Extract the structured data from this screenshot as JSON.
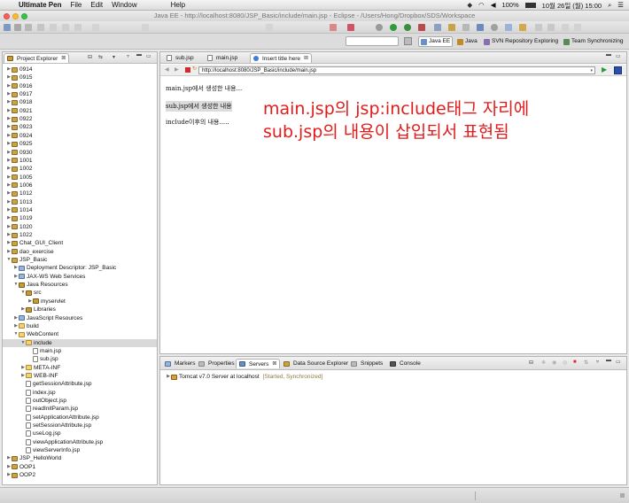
{
  "menubar": {
    "apple": "",
    "app_name": "Ultimate Pen",
    "items": [
      "File",
      "Edit",
      "Window",
      "Help"
    ],
    "battery": "100%",
    "clock": "10월 26일 (월)  15:00"
  },
  "window": {
    "title": "Java EE - http://localhost:8080/JSP_Basic/include/main.jsp - Eclipse - /Users/Hong/Dropbox/SDS/Workspace"
  },
  "perspectives": [
    {
      "label": "Java EE",
      "color": "#6b8fc7"
    },
    {
      "label": "Java",
      "color": "#c08a2a"
    },
    {
      "label": "SVN Repository Exploring",
      "color": "#8a6fb0"
    },
    {
      "label": "Team Synchronizing",
      "color": "#5a8a5a"
    }
  ],
  "explorer": {
    "tab_label": "Project Explorer",
    "tab_close": "⊠",
    "tree": [
      {
        "label": "0914",
        "indent": 0,
        "icon": "proj",
        "twisty": "▶"
      },
      {
        "label": "0915",
        "indent": 0,
        "icon": "proj",
        "twisty": "▶"
      },
      {
        "label": "0916",
        "indent": 0,
        "icon": "proj",
        "twisty": "▶"
      },
      {
        "label": "0917",
        "indent": 0,
        "icon": "proj",
        "twisty": "▶"
      },
      {
        "label": "0918",
        "indent": 0,
        "icon": "proj",
        "twisty": "▶"
      },
      {
        "label": "0921",
        "indent": 0,
        "icon": "proj",
        "twisty": "▶"
      },
      {
        "label": "0922",
        "indent": 0,
        "icon": "proj",
        "twisty": "▶"
      },
      {
        "label": "0923",
        "indent": 0,
        "icon": "proj",
        "twisty": "▶"
      },
      {
        "label": "0924",
        "indent": 0,
        "icon": "proj",
        "twisty": "▶"
      },
      {
        "label": "0925",
        "indent": 0,
        "icon": "proj",
        "twisty": "▶"
      },
      {
        "label": "0930",
        "indent": 0,
        "icon": "proj",
        "twisty": "▶"
      },
      {
        "label": "1001",
        "indent": 0,
        "icon": "proj",
        "twisty": "▶"
      },
      {
        "label": "1002",
        "indent": 0,
        "icon": "proj",
        "twisty": "▶"
      },
      {
        "label": "1005",
        "indent": 0,
        "icon": "proj",
        "twisty": "▶"
      },
      {
        "label": "1006",
        "indent": 0,
        "icon": "proj",
        "twisty": "▶"
      },
      {
        "label": "1012",
        "indent": 0,
        "icon": "proj",
        "twisty": "▶"
      },
      {
        "label": "1013",
        "indent": 0,
        "icon": "proj",
        "twisty": "▶"
      },
      {
        "label": "1014",
        "indent": 0,
        "icon": "proj",
        "twisty": "▶"
      },
      {
        "label": "1019",
        "indent": 0,
        "icon": "proj",
        "twisty": "▶"
      },
      {
        "label": "1020",
        "indent": 0,
        "icon": "proj",
        "twisty": "▶"
      },
      {
        "label": "1022",
        "indent": 0,
        "icon": "proj",
        "twisty": "▶"
      },
      {
        "label": "Chat_GUI_Client",
        "indent": 0,
        "icon": "proj",
        "twisty": "▶"
      },
      {
        "label": "dao_exercise",
        "indent": 0,
        "icon": "proj",
        "twisty": "▶"
      },
      {
        "label": "JSP_Basic",
        "indent": 0,
        "icon": "proj",
        "twisty": "▼"
      },
      {
        "label": "Deployment Descriptor: JSP_Basic",
        "indent": 1,
        "icon": "misc",
        "twisty": "▶"
      },
      {
        "label": "JAX-WS Web Services",
        "indent": 1,
        "icon": "misc",
        "twisty": "▶"
      },
      {
        "label": "Java Resources",
        "indent": 1,
        "icon": "pkg",
        "twisty": "▼"
      },
      {
        "label": "src",
        "indent": 2,
        "icon": "pkg",
        "twisty": "▼"
      },
      {
        "label": "myservlet",
        "indent": 3,
        "icon": "pkg",
        "twisty": "▶"
      },
      {
        "label": "Libraries",
        "indent": 2,
        "icon": "pkg",
        "twisty": "▶"
      },
      {
        "label": "JavaScript Resources",
        "indent": 1,
        "icon": "misc",
        "twisty": "▶"
      },
      {
        "label": "build",
        "indent": 1,
        "icon": "fold",
        "twisty": "▶"
      },
      {
        "label": "WebContent",
        "indent": 1,
        "icon": "fold",
        "twisty": "▼"
      },
      {
        "label": "include",
        "indent": 2,
        "icon": "fold",
        "twisty": "▼",
        "selected": true
      },
      {
        "label": "main.jsp",
        "indent": 3,
        "icon": "jsp",
        "twisty": ""
      },
      {
        "label": "sub.jsp",
        "indent": 3,
        "icon": "jsp",
        "twisty": ""
      },
      {
        "label": "META-INF",
        "indent": 2,
        "icon": "fold",
        "twisty": "▶"
      },
      {
        "label": "WEB-INF",
        "indent": 2,
        "icon": "fold",
        "twisty": "▶"
      },
      {
        "label": "getSessionAttribute.jsp",
        "indent": 2,
        "icon": "jsp",
        "twisty": ""
      },
      {
        "label": "index.jsp",
        "indent": 2,
        "icon": "jsp",
        "twisty": ""
      },
      {
        "label": "outObject.jsp",
        "indent": 2,
        "icon": "jsp",
        "twisty": ""
      },
      {
        "label": "readInitParam.jsp",
        "indent": 2,
        "icon": "jsp",
        "twisty": ""
      },
      {
        "label": "setApplicationAttribute.jsp",
        "indent": 2,
        "icon": "jsp",
        "twisty": ""
      },
      {
        "label": "setSessionAttribute.jsp",
        "indent": 2,
        "icon": "jsp",
        "twisty": ""
      },
      {
        "label": "useLog.jsp",
        "indent": 2,
        "icon": "jsp",
        "twisty": ""
      },
      {
        "label": "viewApplicationAttribute.jsp",
        "indent": 2,
        "icon": "jsp",
        "twisty": ""
      },
      {
        "label": "viewServerInfo.jsp",
        "indent": 2,
        "icon": "jsp",
        "twisty": ""
      },
      {
        "label": "JSP_HelloWorld",
        "indent": 0,
        "icon": "proj",
        "twisty": "▶"
      },
      {
        "label": "OOP1",
        "indent": 0,
        "icon": "proj",
        "twisty": "▶"
      },
      {
        "label": "OOP2",
        "indent": 0,
        "icon": "proj",
        "twisty": "▶"
      }
    ]
  },
  "editor": {
    "tabs": [
      {
        "label": "sub.jsp"
      },
      {
        "label": "main.jsp"
      },
      {
        "label": "Insert title here",
        "active": true,
        "close": "⊠"
      }
    ],
    "url": "http://localhost:8080/JSP_Basic/include/main.jsp",
    "lines": [
      "main.jsp에서 생성한 내용...",
      "sub.jsp에서 생성한 내용",
      "include이후의 내용....."
    ],
    "annotation": {
      "line1": "main.jsp의 jsp:include태그 자리에",
      "line2": "sub.jsp의 내용이 삽입되서 표현됨"
    }
  },
  "bottom_panel": {
    "tabs": [
      {
        "label": "Markers"
      },
      {
        "label": "Properties"
      },
      {
        "label": "Servers",
        "active": true
      },
      {
        "label": "Data Source Explorer"
      },
      {
        "label": "Snippets"
      },
      {
        "label": "Console"
      }
    ],
    "server_name": "Tomcat v7.0 Server at localhost",
    "server_status": "[Started, Synchronized]",
    "twisty": "▶"
  }
}
